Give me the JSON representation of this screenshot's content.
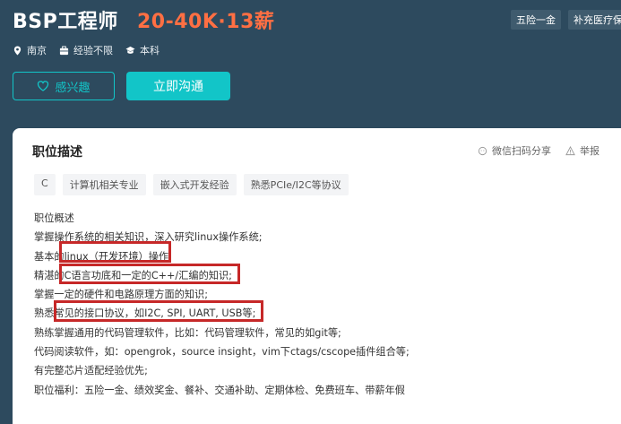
{
  "job": {
    "title": "BSP工程师",
    "salary": "20-40K·13薪",
    "benefits": [
      "五险一金",
      "补充医疗保"
    ],
    "meta": {
      "location": "南京",
      "experience": "经验不限",
      "education": "本科"
    }
  },
  "actions": {
    "interest_label": "感兴趣",
    "chat_label": "立即沟通"
  },
  "card": {
    "title": "职位描述",
    "share_label": "微信扫码分享",
    "report_label": "举报",
    "tags": [
      "C",
      "计算机相关专业",
      "嵌入式开发经验",
      "熟悉PCIe/I2C等协议"
    ],
    "description_lines": [
      "职位概述",
      "掌握操作系统的相关知识，深入研究linux操作系统;",
      "基本的linux（开发环境）操作",
      "精湛的C语言功底和一定的C++/汇编的知识;",
      "掌握一定的硬件和电路原理方面的知识;",
      "熟悉常见的接口协议，如I2C, SPI, UART, USB等;",
      "熟练掌握通用的代码管理软件，比如：代码管理软件，常见的如git等;",
      "代码阅读软件，如：opengrok，source insight，vim下ctags/cscope插件组合等;",
      "有完整芯片适配经验优先;",
      "职位福利：五险一金、绩效奖金、餐补、交通补助、定期体检、免费班车、带薪年假"
    ]
  },
  "colors": {
    "header_bg": "#2d4a5e",
    "accent": "#12c5c8",
    "salary": "#ff6f43",
    "highlight": "#c62828"
  }
}
